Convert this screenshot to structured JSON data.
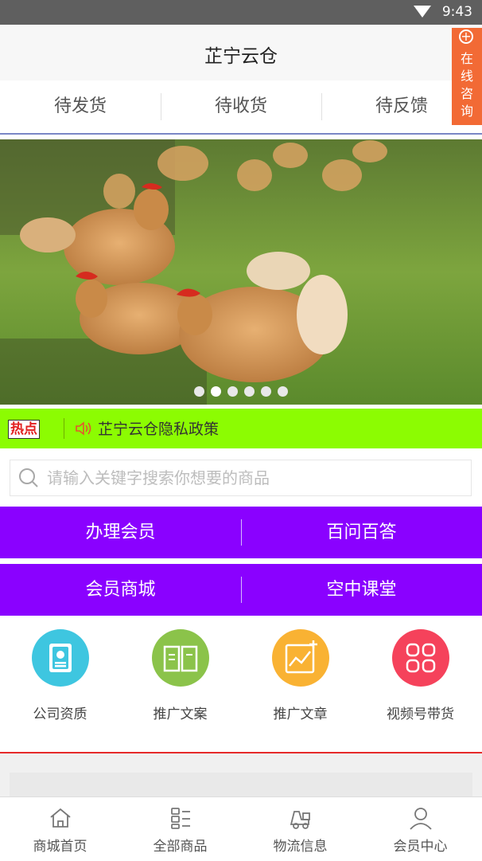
{
  "status_bar": {
    "time": "9:43"
  },
  "header": {
    "title": "芷宁云仓"
  },
  "consult_button": {
    "label": "在线咨询"
  },
  "order_tabs": [
    {
      "label": "待发货"
    },
    {
      "label": "待收货"
    },
    {
      "label": "待反馈"
    }
  ],
  "banner": {
    "image": "chickens-on-grass-photo",
    "slide_count": 6,
    "active_slide": 2
  },
  "hot_news": {
    "badge": "热点",
    "text": "芷宁云仓隐私政策"
  },
  "search": {
    "placeholder": "请输入关键字搜索你想要的商品",
    "value": ""
  },
  "menu_rows": [
    {
      "left": "办理会员",
      "right": "百问百答"
    },
    {
      "left": "会员商城",
      "right": "空中课堂"
    }
  ],
  "features": [
    {
      "label": "公司资质",
      "icon": "certificate-icon",
      "color": "#3ec6e0"
    },
    {
      "label": "推广文案",
      "icon": "open-book-icon",
      "color": "#8bc34a"
    },
    {
      "label": "推广文章",
      "icon": "chart-article-icon",
      "color": "#f9b233"
    },
    {
      "label": "视频号带货",
      "icon": "grid-apps-icon",
      "color": "#f5425b"
    }
  ],
  "bottom_nav": [
    {
      "label": "商城首页",
      "icon": "home-icon"
    },
    {
      "label": "全部商品",
      "icon": "list-icon"
    },
    {
      "label": "物流信息",
      "icon": "forklift-icon"
    },
    {
      "label": "会员中心",
      "icon": "user-icon"
    }
  ],
  "colors": {
    "accent_purple": "#8a01ff",
    "hot_bar": "#8cfc02",
    "consult": "#f26a35",
    "divider_red": "#e62a2a"
  }
}
